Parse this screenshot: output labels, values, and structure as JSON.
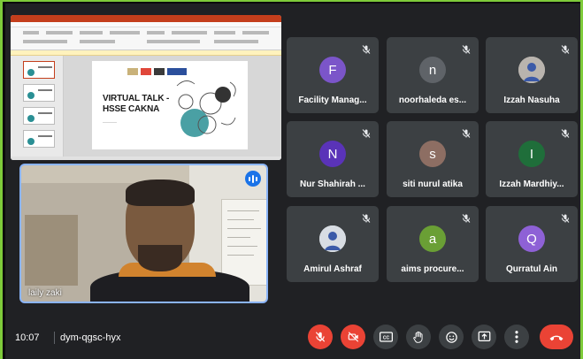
{
  "presentation": {
    "slide_title": "VIRTUAL TALK - HSSE CAKNA",
    "slide_title_line1": "VIRTUAL TALK -",
    "slide_title_line2": "HSSE CAKNA"
  },
  "self_view": {
    "name": "laily zaki",
    "speaking_icon": "audio-level-icon",
    "accent": "#8ab4f8"
  },
  "participants": [
    {
      "name": "Facility Manag...",
      "initial": "F",
      "color": "#7b55c9"
    },
    {
      "name": "noorhaleda es...",
      "initial": "n",
      "color": "#5f6368"
    },
    {
      "name": "Izzah Nasuha",
      "initial": "",
      "color": "#b9b4ae",
      "photo": true
    },
    {
      "name": "Nur Shahirah ...",
      "initial": "N",
      "color": "#5a33b8"
    },
    {
      "name": "siti nurul atika",
      "initial": "s",
      "color": "#8d6e63"
    },
    {
      "name": "Izzah Mardhiy...",
      "initial": "I",
      "color": "#1f6e3a"
    },
    {
      "name": "Amirul Ashraf",
      "initial": "",
      "color": "#d8dde3",
      "photo": true
    },
    {
      "name": "aims procure...",
      "initial": "a",
      "color": "#6a9f35"
    },
    {
      "name": "Qurratul Ain",
      "initial": "Q",
      "color": "#8e61d6"
    }
  ],
  "meeting": {
    "time": "10:07",
    "code": "dym-qgsc-hyx"
  },
  "controls": {
    "mic": "mic-off-icon",
    "camera": "camera-off-icon",
    "captions": "captions-icon",
    "hand": "raise-hand-icon",
    "emoji": "emoji-icon",
    "present": "present-icon",
    "more": "more-vert-icon",
    "leave": "leave-call-icon"
  },
  "colors": {
    "background": "#202124",
    "tile": "#3c4043",
    "danger": "#ea4335",
    "frame": "#7ecb3a"
  }
}
